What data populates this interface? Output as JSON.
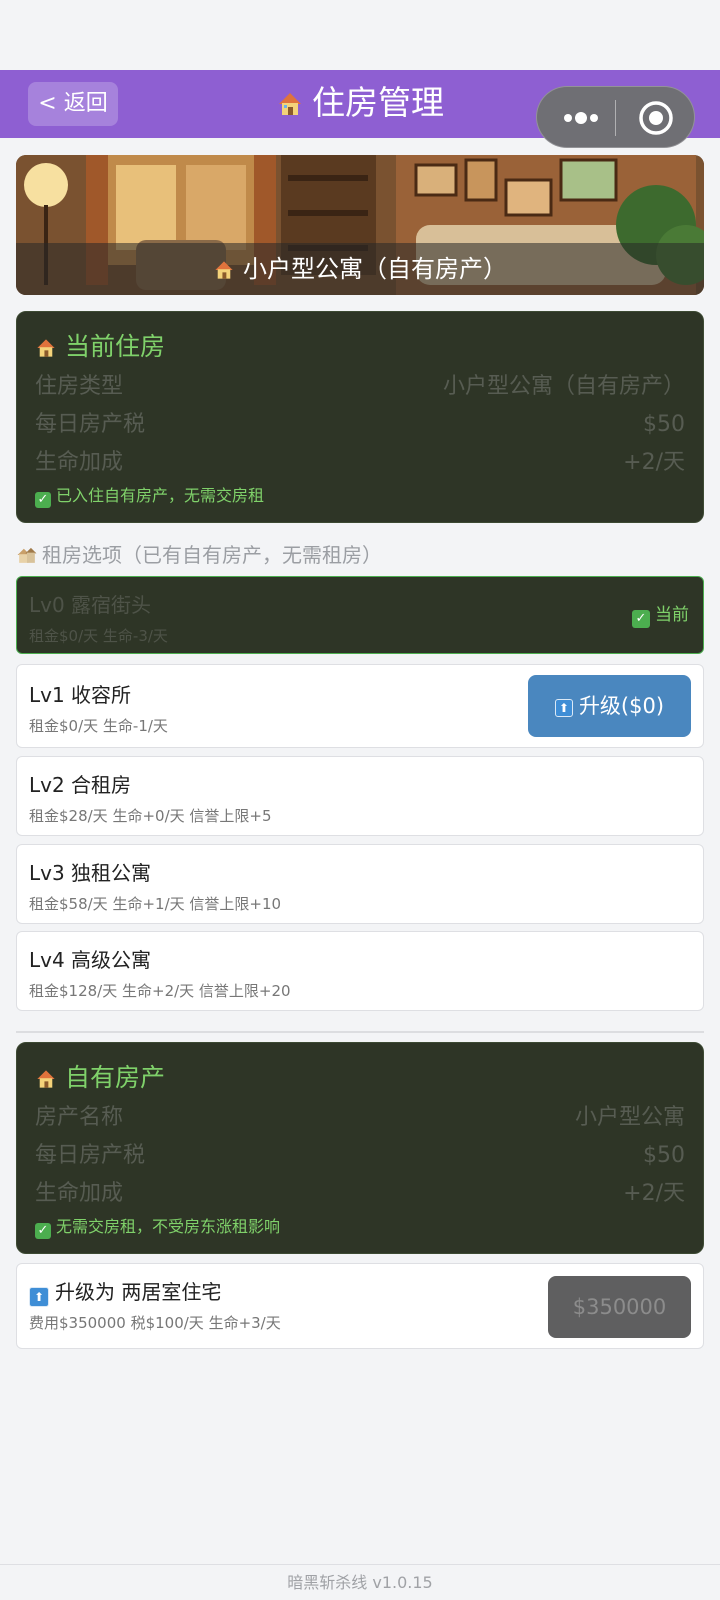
{
  "header": {
    "back_label": "< 返回",
    "title": "住房管理"
  },
  "banner": {
    "caption": "小户型公寓（自有房产）"
  },
  "current_housing": {
    "title": "当前住房",
    "rows": [
      {
        "label": "住房类型",
        "value": "小户型公寓（自有房产）"
      },
      {
        "label": "每日房产税",
        "value": "$50"
      },
      {
        "label": "生命加成",
        "value": "+2/天"
      }
    ],
    "note": "已入住自有房产，无需交房租"
  },
  "rental_section_label": "租房选项（已有自有房产，无需租房）",
  "rental_options": [
    {
      "name": "Lv0 露宿街头",
      "detail": "租金$0/天  生命-3/天",
      "badge": "当前"
    },
    {
      "name": "Lv1 收容所",
      "detail": "租金$0/天  生命-1/天",
      "button": "升级($0)"
    },
    {
      "name": "Lv2 合租房",
      "detail": "租金$28/天  生命+0/天  信誉上限+5"
    },
    {
      "name": "Lv3 独租公寓",
      "detail": "租金$58/天  生命+1/天  信誉上限+10"
    },
    {
      "name": "Lv4 高级公寓",
      "detail": "租金$128/天  生命+2/天  信誉上限+20"
    }
  ],
  "own_property": {
    "title": "自有房产",
    "rows": [
      {
        "label": "房产名称",
        "value": "小户型公寓"
      },
      {
        "label": "每日房产税",
        "value": "$50"
      },
      {
        "label": "生命加成",
        "value": "+2/天"
      }
    ],
    "note": "无需交房租，不受房东涨租影响"
  },
  "property_upgrade": {
    "title": "升级为 两居室住宅",
    "detail": "费用$350000  税$100/天  生命+3/天",
    "price": "$350000"
  },
  "footer": "暗黑斩杀线 v1.0.15",
  "colors": {
    "header": "#8e5fd2",
    "dark_card": "#2e3526",
    "accent_green": "#7fd16a",
    "upgrade_blue": "#4a87bf"
  }
}
